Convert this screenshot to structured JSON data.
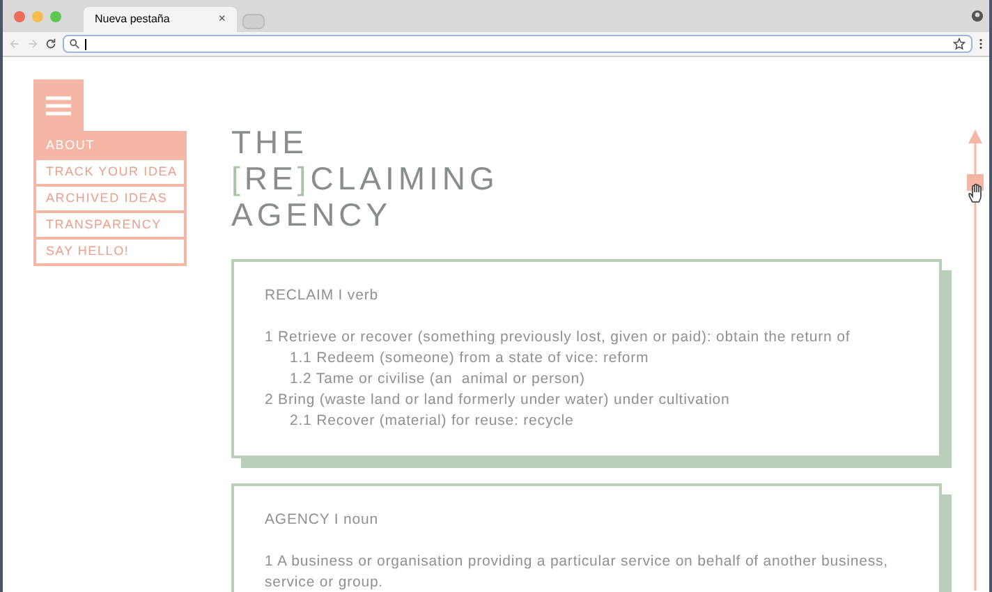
{
  "browser": {
    "tab_title": "Nueva pestaña",
    "tab_close": "×"
  },
  "menu": {
    "items": [
      {
        "label": "ABOUT",
        "selected": true
      },
      {
        "label": "TRACK YOUR IDEA",
        "selected": false
      },
      {
        "label": "ARCHIVED IDEAS",
        "selected": false
      },
      {
        "label": "TRANSPARENCY",
        "selected": false
      },
      {
        "label": "SAY HELLO!",
        "selected": false
      }
    ]
  },
  "title": {
    "lines": [
      [
        {
          "text": "THE",
          "accent": false
        }
      ],
      [
        {
          "text": "[",
          "accent": true
        },
        {
          "text": "RE",
          "accent": false
        },
        {
          "text": "]",
          "accent": true
        },
        {
          "text": "CLAIMING",
          "accent": false
        }
      ],
      [
        {
          "text": "AGENCY",
          "accent": false
        }
      ]
    ]
  },
  "definitions": [
    {
      "heading": "RECLAIM I verb",
      "senses": [
        {
          "text": "1 Retrieve or recover (something previously lost, given or paid): obtain the return of",
          "children": [
            {
              "text": "1.1 Redeem (someone) from a state of vice: reform"
            },
            {
              "text": "1.2 Tame or civilise (an  animal or person)"
            }
          ]
        },
        {
          "text": "2 Bring (waste land or land formerly under water) under cultivation",
          "children": [
            {
              "text": "2.1 Recover (material) for reuse: recycle"
            }
          ]
        }
      ]
    },
    {
      "heading": "AGENCY I noun",
      "senses": [
        {
          "text": "1 A business or organisation providing a particular service on behalf of another business, service or group."
        }
      ]
    }
  ]
}
